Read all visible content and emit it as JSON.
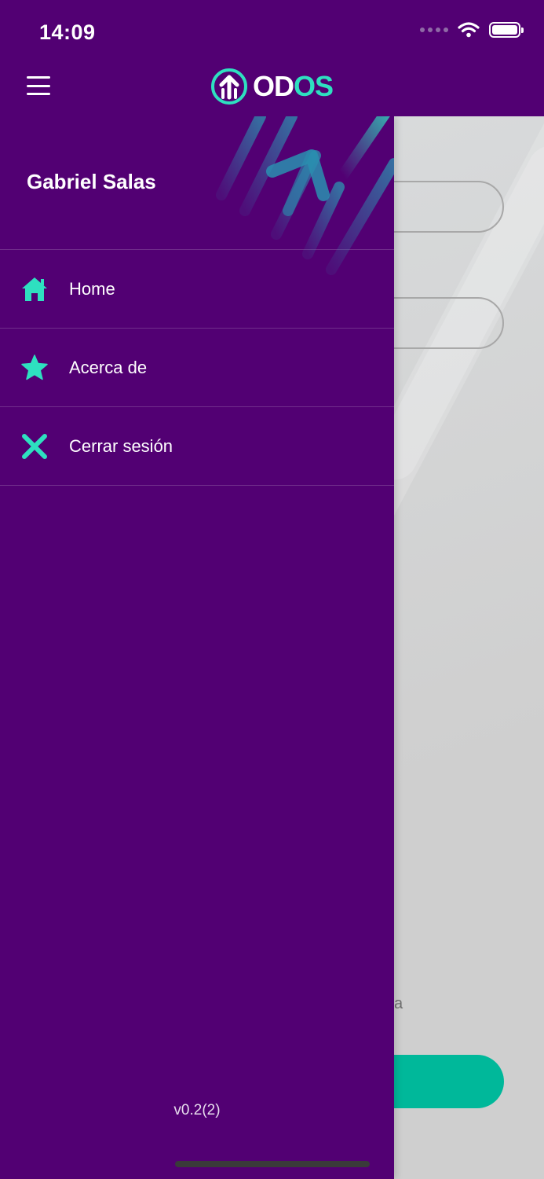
{
  "status_bar": {
    "time": "14:09",
    "wifi_icon": "wifi-icon",
    "battery_icon": "battery-icon"
  },
  "header": {
    "menu_icon": "hamburger-menu-icon",
    "logo_prefix": "OD",
    "logo_suffix": "OS",
    "logo_icon": "up-arrow-circle-icon"
  },
  "drawer": {
    "user_name": "Gabriel Salas",
    "items": [
      {
        "label": "Home",
        "icon": "home-icon"
      },
      {
        "label": "Acerca de",
        "icon": "star-icon"
      },
      {
        "label": "Cerrar sesión",
        "icon": "close-icon"
      }
    ],
    "version": "v0.2(2)"
  },
  "background_page": {
    "partial_text": "a"
  },
  "colors": {
    "purple": "#520073",
    "accent": "#2ee0c0",
    "button": "#00b89a"
  }
}
